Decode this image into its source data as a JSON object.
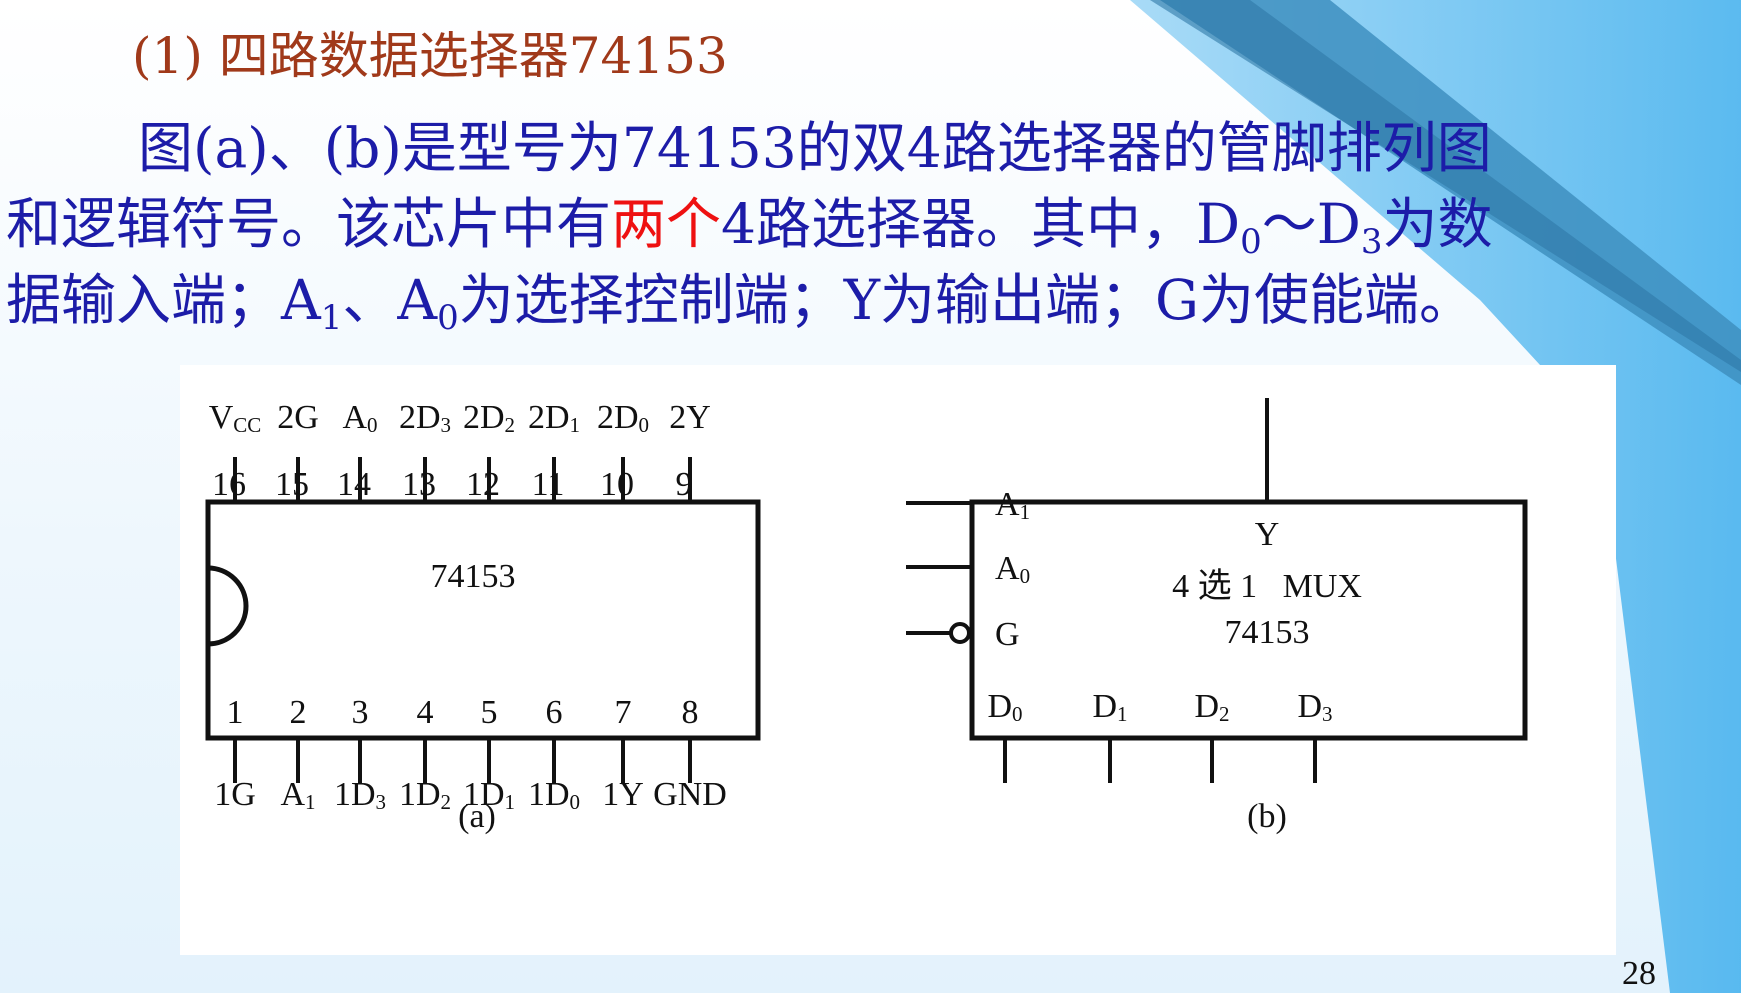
{
  "slide": {
    "heading": "(1) 四路数据选择器74153",
    "paragraph": {
      "line1": "图(a)、(b)是型号为74153的双4路选择器的管脚排列图",
      "line2_a": "和逻辑符号。该芯片中有",
      "line2_highlight": "两个",
      "line2_b": "4路选择器。其中，D",
      "line2_sub1": "0",
      "line2_c": "～D",
      "line2_sub2": "3",
      "line2_d": "为数",
      "line3_a": "据输入端；A",
      "line3_sub1": "1",
      "line3_b": "、A",
      "line3_sub2": "0",
      "line3_c": "为选择控制端；Y为输出端；G为使能端。"
    },
    "page_number": "28",
    "colors": {
      "heading": "#a0391a",
      "body": "#1c1ca8",
      "highlight": "#ee1111",
      "accent": "#4bb6f0"
    }
  },
  "pinout": {
    "chip_label": "74153",
    "caption": "(a)",
    "top_pins": [
      {
        "number": "16",
        "name": "V",
        "sub": "CC"
      },
      {
        "number": "15",
        "name": "2G",
        "sub": ""
      },
      {
        "number": "14",
        "name": "A",
        "sub": "0"
      },
      {
        "number": "13",
        "name": "2D",
        "sub": "3"
      },
      {
        "number": "12",
        "name": "2D",
        "sub": "2"
      },
      {
        "number": "11",
        "name": "2D",
        "sub": "1"
      },
      {
        "number": "10",
        "name": "2D",
        "sub": "0"
      },
      {
        "number": "9",
        "name": "2Y",
        "sub": ""
      }
    ],
    "bottom_pins": [
      {
        "number": "1",
        "name": "1G",
        "sub": ""
      },
      {
        "number": "2",
        "name": "A",
        "sub": "1"
      },
      {
        "number": "3",
        "name": "1D",
        "sub": "3"
      },
      {
        "number": "4",
        "name": "1D",
        "sub": "2"
      },
      {
        "number": "5",
        "name": "1D",
        "sub": "1"
      },
      {
        "number": "6",
        "name": "1D",
        "sub": "0"
      },
      {
        "number": "7",
        "name": "1Y",
        "sub": ""
      },
      {
        "number": "8",
        "name": "GND",
        "sub": ""
      }
    ]
  },
  "logic_symbol": {
    "output": "Y",
    "function": "4 选 1   MUX",
    "part": "74153",
    "caption": "(b)",
    "left_inputs": [
      {
        "name": "A",
        "sub": "1"
      },
      {
        "name": "A",
        "sub": "0"
      },
      {
        "name": "G",
        "sub": ""
      }
    ],
    "data_inputs": [
      {
        "name": "D",
        "sub": "0"
      },
      {
        "name": "D",
        "sub": "1"
      },
      {
        "name": "D",
        "sub": "2"
      },
      {
        "name": "D",
        "sub": "3"
      }
    ]
  }
}
